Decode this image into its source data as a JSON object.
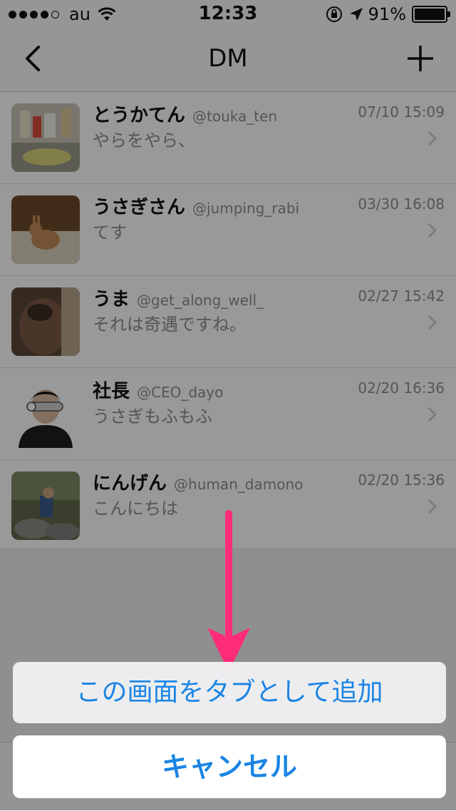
{
  "status_bar": {
    "carrier": "au",
    "time": "12:33",
    "battery": "91%",
    "battery_level": 0.91
  },
  "nav": {
    "title": "DM",
    "back_icon": "chevron-left-icon",
    "add_icon": "plus-icon"
  },
  "messages": [
    {
      "name": "とうかてん",
      "handle": "@touka_ten",
      "time": "07/10 15:09",
      "preview": "やらをやら、"
    },
    {
      "name": "うさぎさん",
      "handle": "@jumping_rabi",
      "time": "03/30 16:08",
      "preview": "てす"
    },
    {
      "name": "うま",
      "handle": "@get_along_well_",
      "time": "02/27 15:42",
      "preview": "それは奇遇ですね。"
    },
    {
      "name": "社長",
      "handle": "@CEO_dayo",
      "time": "02/20 16:36",
      "preview": "うさぎもふもふ"
    },
    {
      "name": "にんげん",
      "handle": "@human_damono",
      "time": "02/20 15:36",
      "preview": "こんにちは"
    }
  ],
  "action_sheet": {
    "add_tab_label": "この画面をタブとして追加",
    "cancel_label": "キャンセル"
  },
  "colors": {
    "accent": "#1a84e4",
    "arrow": "#ff2d79"
  }
}
